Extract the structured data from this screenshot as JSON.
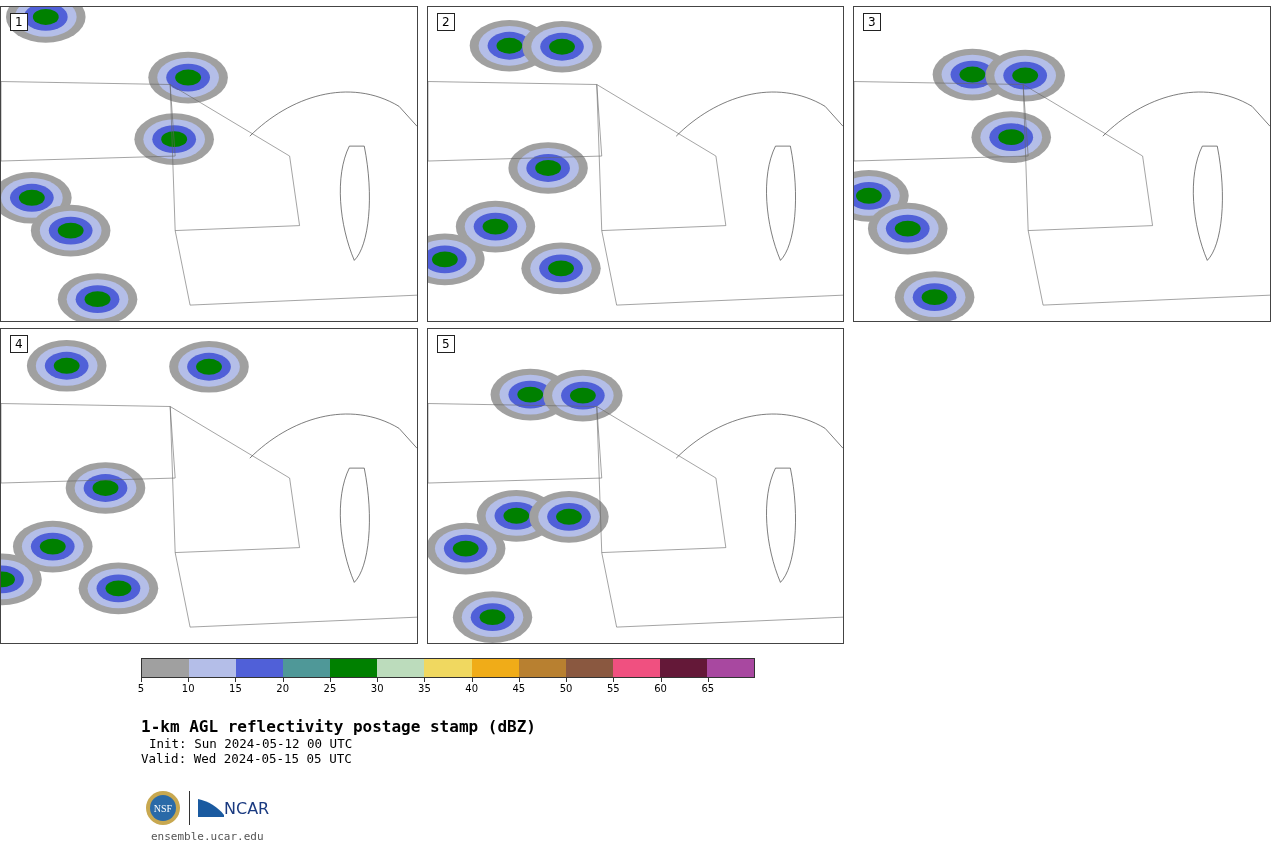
{
  "panels": [
    {
      "label": "1"
    },
    {
      "label": "2"
    },
    {
      "label": "3"
    },
    {
      "label": "4"
    },
    {
      "label": "5"
    }
  ],
  "colorbar": [
    {
      "label": "5",
      "color": "#a0a0a0"
    },
    {
      "label": "10",
      "color": "#b4bee8"
    },
    {
      "label": "15",
      "color": "#5060d8"
    },
    {
      "label": "20",
      "color": "#4f9898"
    },
    {
      "label": "25",
      "color": "#008000"
    },
    {
      "label": "30",
      "color": "#bcdcbc"
    },
    {
      "label": "35",
      "color": "#f0d860"
    },
    {
      "label": "40",
      "color": "#f0ac18"
    },
    {
      "label": "45",
      "color": "#b88030"
    },
    {
      "label": "50",
      "color": "#8a5840"
    },
    {
      "label": "55",
      "color": "#f05080"
    },
    {
      "label": "60",
      "color": "#641838"
    },
    {
      "label": "65",
      "color": "#a848a0"
    }
  ],
  "title": "1-km AGL reflectivity postage stamp (dBZ)",
  "init": "Init: Sun 2024-05-12 00 UTC",
  "valid": "Valid: Wed 2024-05-15 05 UTC",
  "logos": {
    "nsf": "NSF",
    "ncar": "NCAR"
  },
  "footer": "ensemble.ucar.edu"
}
